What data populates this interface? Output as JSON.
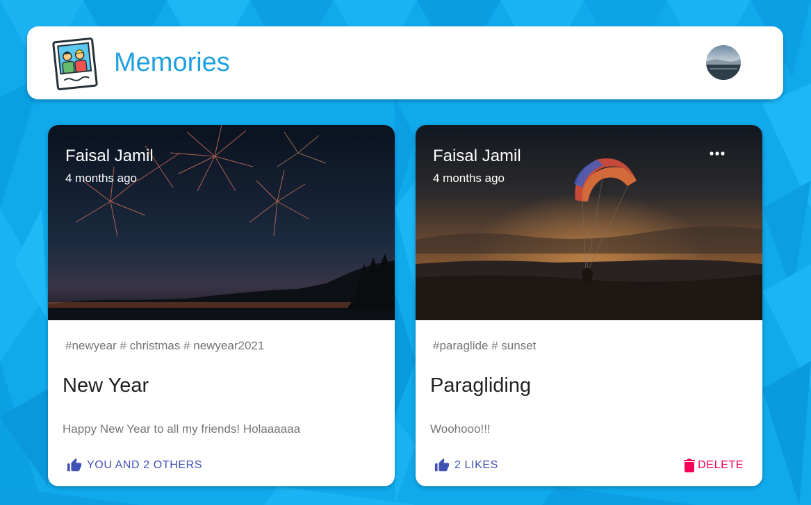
{
  "app": {
    "title": "Memories"
  },
  "colors": {
    "background": "#0fa9ec",
    "brand": "#1e9fe0",
    "like": "#3f51b5",
    "delete": "#f50057"
  },
  "icons": {
    "logo": "photo-frame-people-icon",
    "like": "thumb-up-icon",
    "delete": "trash-icon",
    "more": "more-horizontal-icon"
  },
  "posts": [
    {
      "author": "Faisal Jamil",
      "time": "4 months ago",
      "tags": "#newyear # christmas # newyear2021",
      "title": "New Year",
      "message": "Happy New Year to all my friends! Holaaaaaa",
      "like_label": "YOU AND 2 OTHERS",
      "image": "fireworks-over-lake"
    },
    {
      "author": "Faisal Jamil",
      "time": "4 months ago",
      "tags": "#paraglide # sunset",
      "title": "Paragliding",
      "message": "Woohooo!!!",
      "like_label": "2 LIKES",
      "delete_label": "DELETE",
      "image": "paraglider-at-sunset"
    }
  ]
}
